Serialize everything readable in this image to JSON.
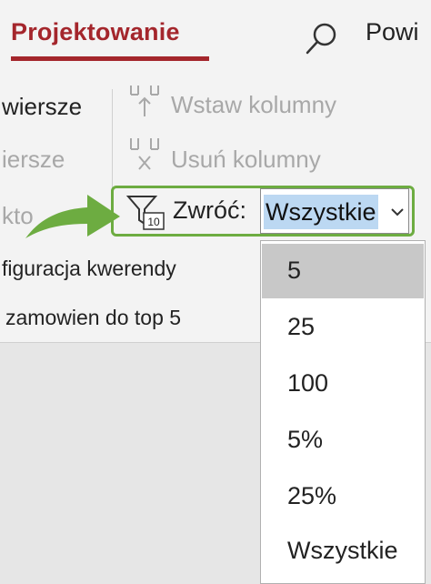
{
  "tabs": {
    "active_label": "Projektowanie",
    "next_label": "Powi"
  },
  "ribbon": {
    "row1_left": "wiersze",
    "row2_left": "iersze",
    "row3_left": "kto",
    "insert_columns": "Wstaw kolumny",
    "delete_columns": "Usuń kolumny",
    "return_label": "Zwróć:",
    "return_value": "Wszystkie",
    "group_label": "figuracja kwerendy"
  },
  "formula": {
    "text": "zamowien do top 5"
  },
  "dropdown": {
    "options": [
      "5",
      "25",
      "100",
      "5%",
      "25%",
      "Wszystkie"
    ],
    "highlighted": "5"
  },
  "colors": {
    "accent": "#a4262c",
    "highlight_box": "#6dac41",
    "selection": "#bcd8f2"
  },
  "icons": [
    "search-icon",
    "insert-column-icon",
    "delete-column-icon",
    "filter-top-values-icon",
    "chevron-down-icon",
    "green-arrow-icon"
  ]
}
